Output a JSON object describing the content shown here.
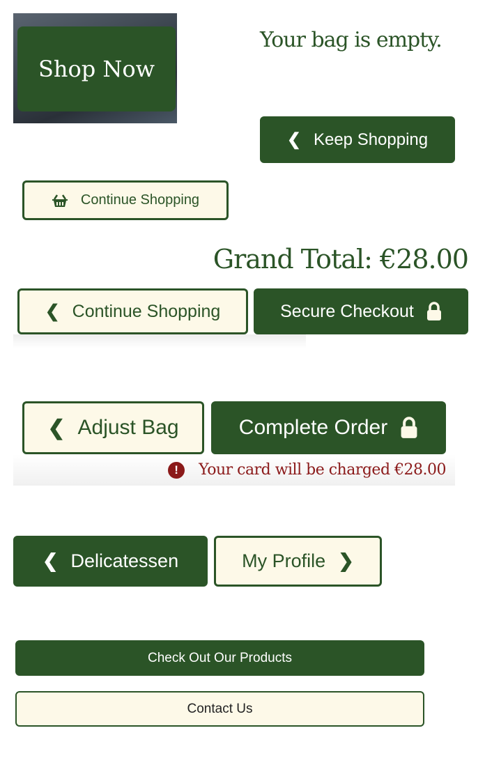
{
  "hero": {
    "shop_now": "Shop Now"
  },
  "empty_bag": {
    "message": "Your bag is empty.",
    "keep_shopping": "Keep Shopping",
    "continue_shopping": "Continue Shopping"
  },
  "bag": {
    "grand_total": "Grand Total: €28.00",
    "continue_shopping": "Continue Shopping",
    "secure_checkout": "Secure Checkout"
  },
  "checkout": {
    "adjust_bag": "Adjust Bag",
    "complete_order": "Complete Order",
    "charge_warning": "Your card will be charged €28.00"
  },
  "profile": {
    "delicatessen": "Delicatessen",
    "my_profile": "My Profile"
  },
  "footer": {
    "check_products": "Check Out Our Products",
    "contact_us": "Contact Us"
  },
  "colors": {
    "primary": "#2b5427",
    "cream": "#fdf9e8",
    "warning": "#8b1a1a"
  }
}
